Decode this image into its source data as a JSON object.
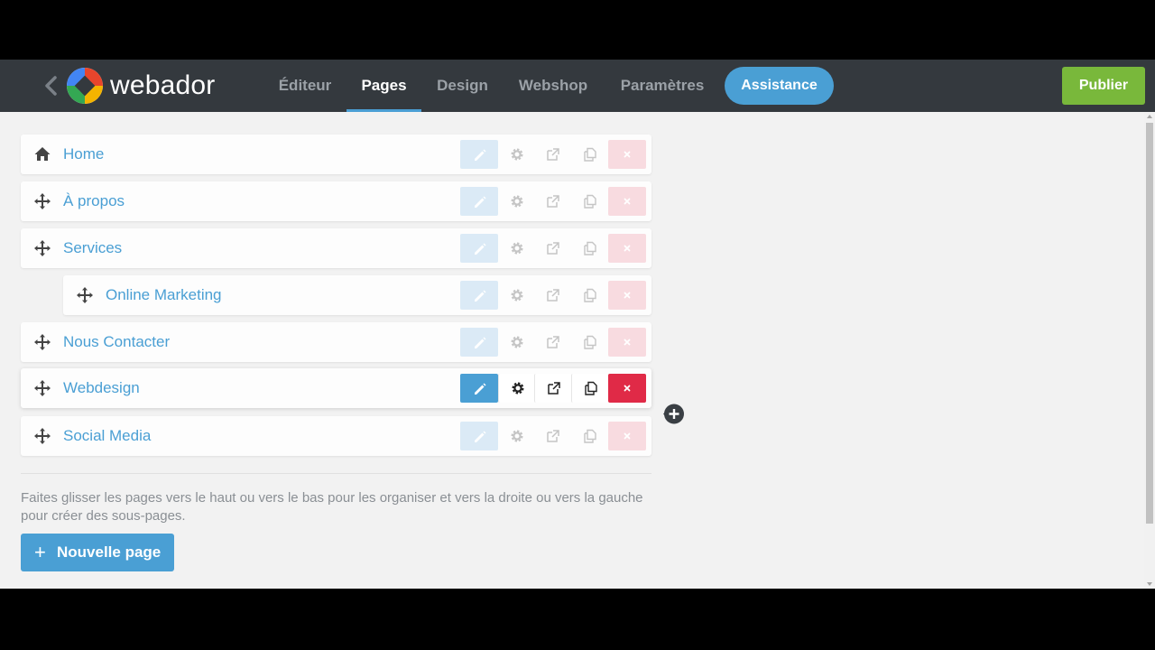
{
  "brand": {
    "name": "webador"
  },
  "nav": {
    "items": [
      {
        "label": "Éditeur"
      },
      {
        "label": "Pages"
      },
      {
        "label": "Design"
      },
      {
        "label": "Webshop"
      },
      {
        "label": "Paramètres"
      }
    ],
    "active": "Pages",
    "assist_label": "Assistance",
    "publish_label": "Publier"
  },
  "pages": [
    {
      "label": "Home",
      "icon": "home-icon"
    },
    {
      "label": "À propos",
      "icon": "move-icon"
    },
    {
      "label": "Services",
      "icon": "move-icon"
    },
    {
      "label": "Online Marketing",
      "icon": "move-icon",
      "subpage_of": "Services"
    },
    {
      "label": "Nous Contacter",
      "icon": "move-icon"
    },
    {
      "label": "Webdesign",
      "icon": "move-icon",
      "hovered": true
    },
    {
      "label": "Social Media",
      "icon": "move-icon"
    }
  ],
  "row_actions": [
    "edit-icon",
    "gear-icon",
    "external-link-icon",
    "copy-icon",
    "close-icon"
  ],
  "help_text": "Faites glisser les pages vers le haut ou vers le bas pour les organiser et vers la droite ou vers la gauche pour créer des sous-pages.",
  "new_page": {
    "plus": "+",
    "label": "Nouvelle page"
  },
  "colors": {
    "topbar": "#34393e",
    "accent": "#4a9fd4",
    "publish": "#79b83b",
    "delete": "#e02a47",
    "background": "#f2f2f2"
  }
}
